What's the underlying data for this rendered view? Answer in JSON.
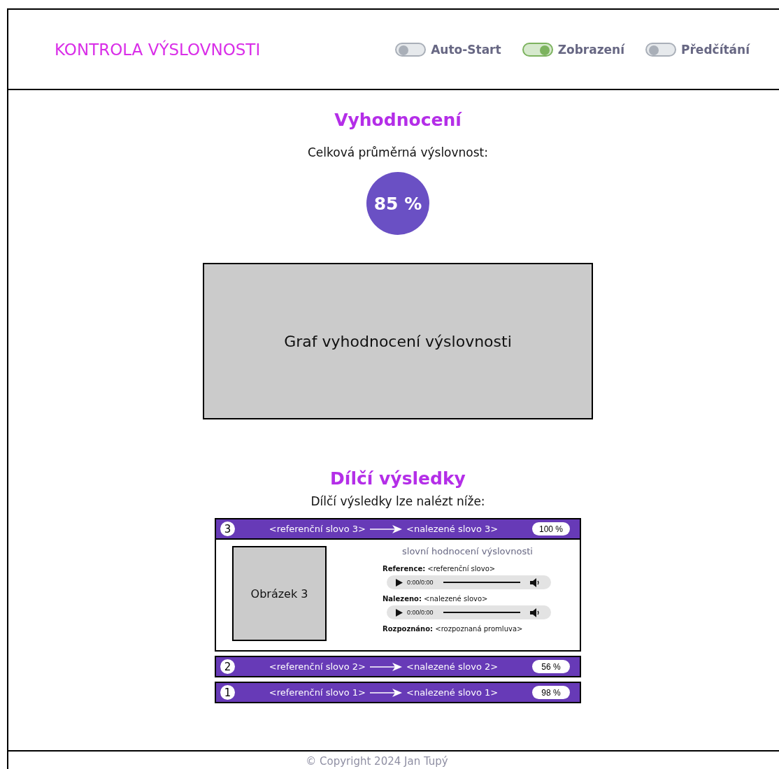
{
  "header": {
    "title": "KONTROLA VÝSLOVNOSTI"
  },
  "toggles": [
    {
      "label": "Auto-Start",
      "on": false
    },
    {
      "label": "Zobrazení",
      "on": true
    },
    {
      "label": "Předčítání",
      "on": false
    }
  ],
  "evaluation": {
    "heading": "Vyhodnocení",
    "average_label": "Celková průměrná výslovnost:",
    "average_score": "85 %",
    "graph_placeholder": "Graf vyhodnocení výslovnosti"
  },
  "partial": {
    "heading": "Dílčí výsledky",
    "subtitle": "Dílčí výsledky lze nalézt níže:"
  },
  "results": [
    {
      "number": "3",
      "reference": "<referenční slovo 3>",
      "found": "<nalezené slovo 3>",
      "score": "100 %",
      "detail": {
        "image_label": "Obrázek 3",
        "rating": "slovní hodnocení výslovnosti",
        "reference": "**Reference:** <referenční slovo>",
        "reference_time": "0:00/0:00",
        "found": "**Nalezeno:** <nalezené slovo>",
        "found_time": "0:00/0:00",
        "recognized": "**Rozpoznáno:** <rozpoznaná promluva>"
      }
    },
    {
      "number": "2",
      "reference": "<referenční slovo 2>",
      "found": "<nalezené slovo 2>",
      "score": "56 %"
    },
    {
      "number": "1",
      "reference": "<referenční slovo 1>",
      "found": "<nalezené slovo 1>",
      "score": "98 %"
    }
  ],
  "footer": {
    "copyright": "© Copyright 2024 Jan Tupý"
  }
}
